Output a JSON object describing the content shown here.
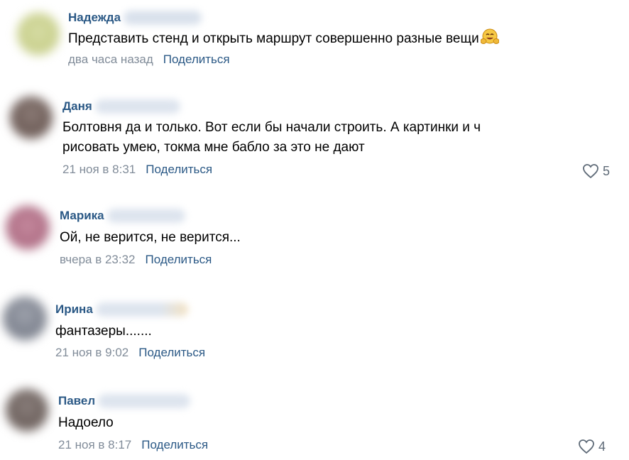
{
  "comments": [
    {
      "author": "Надежда",
      "text": "Представить стенд и открыть маршрут совершенно разные вещи",
      "time": "два часа назад",
      "share": "Поделиться",
      "emoji": "smiling-face-with-open-hands"
    },
    {
      "author": "Даня",
      "text_line1": "Болтовня да и только. Вот если бы начали строить. А картинки и ч",
      "text_line2": "рисовать умею, токма мне бабло за это не дают",
      "time": "21 ноя в 8:31",
      "share": "Поделиться",
      "likes": "5"
    },
    {
      "author": "Марика",
      "text": "Ой, не верится, не верится...",
      "time": "вчера в 23:32",
      "share": "Поделиться"
    },
    {
      "author": "Ирина",
      "text": "фантазеры.......",
      "time": "21 ноя в 9:02",
      "share": "Поделиться"
    },
    {
      "author": "Павел",
      "text": "Надоело",
      "time": "21 ноя в 8:17",
      "share": "Поделиться",
      "likes": "4"
    }
  ],
  "colors": {
    "author": "#2a5885",
    "meta": "#818c99",
    "link": "#2a5885",
    "likes": "#5e6a77"
  }
}
